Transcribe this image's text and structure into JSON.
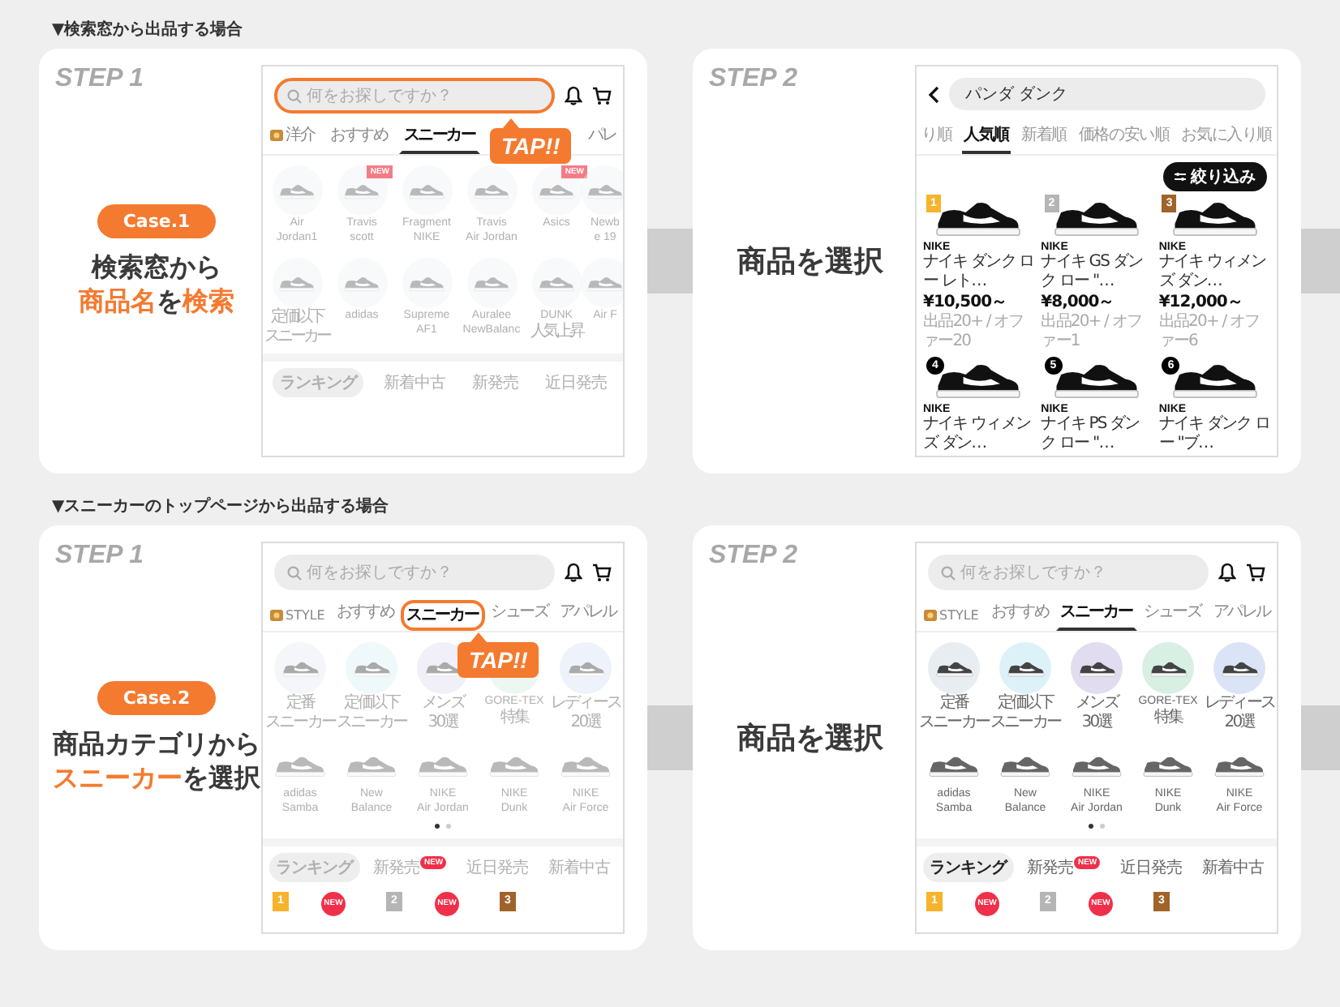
{
  "sections": [
    {
      "heading": "▼検索窓から出品する場合",
      "step1": {
        "step_label": "STEP 1",
        "case_badge": "Case.1",
        "title_lines": [
          [
            {
              "text": "検索窓から",
              "highlight": false
            }
          ],
          [
            {
              "text": "商品名",
              "highlight": true
            },
            {
              "text": "を",
              "highlight": false
            },
            {
              "text": "検索",
              "highlight": true
            }
          ]
        ],
        "screen": {
          "kind": "home",
          "faded": true,
          "search": {
            "placeholder": "何をお探しですか？",
            "highlighted": true
          },
          "callout": {
            "text": "TAP!!"
          },
          "tabs": [
            {
              "label": "洋介",
              "icon": true,
              "selected": false,
              "highlighted": false
            },
            {
              "label": "おすすめ",
              "icon": false,
              "selected": false,
              "highlighted": false
            },
            {
              "label": "スニーカー",
              "icon": false,
              "selected": true,
              "highlighted": false
            },
            {
              "label": "パレ",
              "icon": false,
              "selected": false,
              "highlighted": false
            }
          ],
          "rows": [
            {
              "kind": "circles",
              "items": [
                {
                  "lines": [
                    "Air",
                    "Jordan1"
                  ]
                },
                {
                  "lines": [
                    "Travis",
                    "scott"
                  ],
                  "badge": "NEW"
                },
                {
                  "lines": [
                    "Fragment",
                    "NIKE"
                  ]
                },
                {
                  "lines": [
                    "Travis",
                    "Air Jordan"
                  ]
                },
                {
                  "lines": [
                    "Asics"
                  ],
                  "badge": "NEW"
                },
                {
                  "lines": [
                    "Newb",
                    "e 19"
                  ]
                }
              ]
            },
            {
              "kind": "circles",
              "items": [
                {
                  "lines": [
                    "定価以下",
                    "スニーカー"
                  ]
                },
                {
                  "lines": [
                    "adidas"
                  ]
                },
                {
                  "lines": [
                    "Supreme",
                    "AF1"
                  ]
                },
                {
                  "lines": [
                    "Auralee",
                    "NewBalanc"
                  ]
                },
                {
                  "lines": [
                    "DUNK",
                    "人気上昇"
                  ]
                },
                {
                  "lines": [
                    "Air F"
                  ]
                }
              ]
            }
          ],
          "bottom_tabs": [
            {
              "label": "ランキング",
              "selected": true
            },
            {
              "label": "新着中古",
              "selected": false
            },
            {
              "label": "新発売",
              "selected": false
            },
            {
              "label": "近日発売",
              "selected": false
            }
          ]
        }
      },
      "step2": {
        "step_label": "STEP 2",
        "caption": "商品を選択",
        "screen": {
          "kind": "results",
          "search": {
            "value": "パンダ ダンク"
          },
          "sort_tabs": [
            {
              "label": "り順",
              "selected": false
            },
            {
              "label": "人気順",
              "selected": true
            },
            {
              "label": "新着順",
              "selected": false
            },
            {
              "label": "価格の安い順",
              "selected": false
            },
            {
              "label": "お気に入り順",
              "selected": false
            }
          ],
          "filter_button": "絞り込み",
          "products": [
            {
              "rank": "1",
              "kind": "ribbon",
              "color": "#f7b32b",
              "brand": "NIKE",
              "name": "ナイキ ダンク ロー レト…",
              "price": "¥10,500～",
              "meta": "出品20+ / オファー20"
            },
            {
              "rank": "2",
              "kind": "ribbon",
              "color": "#b5b5b5",
              "brand": "NIKE",
              "name": "ナイキ GS ダンク ロー \"…",
              "price": "¥8,000～",
              "meta": "出品20+ / オファー1"
            },
            {
              "rank": "3",
              "kind": "ribbon",
              "color": "#a0632a",
              "brand": "NIKE",
              "name": "ナイキ ウィメンズ ダン…",
              "price": "¥12,000～",
              "meta": "出品20+ / オファー6"
            },
            {
              "rank": "4",
              "kind": "circle",
              "color": "#000000",
              "brand": "NIKE",
              "name": "ナイキ ウィメンズ ダン…"
            },
            {
              "rank": "5",
              "kind": "circle",
              "color": "#000000",
              "brand": "NIKE",
              "name": "ナイキ PS ダンク ロー \"…"
            },
            {
              "rank": "6",
              "kind": "circle",
              "color": "#000000",
              "brand": "NIKE",
              "name": "ナイキ ダンク ロー \"ブ…"
            }
          ]
        }
      }
    },
    {
      "heading": "▼スニーカーのトップページから出品する場合",
      "step1": {
        "step_label": "STEP 1",
        "case_badge": "Case.2",
        "title_lines": [
          [
            {
              "text": "商品カテゴリから",
              "highlight": false
            }
          ],
          [
            {
              "text": "スニーカー",
              "highlight": true
            },
            {
              "text": "を選択",
              "highlight": false
            }
          ]
        ],
        "screen": {
          "kind": "home",
          "faded": true,
          "search": {
            "placeholder": "何をお探しですか？",
            "highlighted": false
          },
          "callout": {
            "text": "TAP!!"
          },
          "tabs": [
            {
              "label": "STYLE",
              "icon": true,
              "selected": false,
              "highlighted": false
            },
            {
              "label": "おすすめ",
              "icon": false,
              "selected": false,
              "highlighted": false
            },
            {
              "label": "スニーカー",
              "icon": false,
              "selected": true,
              "highlighted": true
            },
            {
              "label": "シューズ",
              "icon": false,
              "selected": false,
              "highlighted": false
            },
            {
              "label": "アパレル",
              "icon": false,
              "selected": false,
              "highlighted": false
            }
          ],
          "rows": [
            {
              "kind": "categories",
              "items": [
                {
                  "lines": [
                    "定番",
                    "スニーカー"
                  ]
                },
                {
                  "lines": [
                    "定価以下",
                    "スニーカー"
                  ]
                },
                {
                  "lines": [
                    "メンズ",
                    "30選"
                  ]
                },
                {
                  "lines": [
                    "GORE-TEX",
                    "特集"
                  ]
                },
                {
                  "lines": [
                    "レディース",
                    "20選"
                  ]
                }
              ]
            },
            {
              "kind": "tiles",
              "items": [
                {
                  "lines": [
                    "adidas",
                    "Samba"
                  ]
                },
                {
                  "lines": [
                    "New",
                    "Balance"
                  ]
                },
                {
                  "lines": [
                    "NIKE",
                    "Air Jordan"
                  ]
                },
                {
                  "lines": [
                    "NIKE",
                    "Dunk"
                  ]
                },
                {
                  "lines": [
                    "NIKE",
                    "Air Force"
                  ]
                }
              ]
            }
          ],
          "pager": [
            {
              "selected": true
            },
            {
              "selected": false
            }
          ],
          "bottom_tabs": [
            {
              "label": "ランキング",
              "selected": true
            },
            {
              "label": "新発売",
              "selected": false,
              "badge": "NEW"
            },
            {
              "label": "近日発売",
              "selected": false
            },
            {
              "label": "新着中古",
              "selected": false
            }
          ],
          "ranking": [
            {
              "rank": "1",
              "color": "#f7b32b",
              "badge": "NEW"
            },
            {
              "rank": "2",
              "color": "#b5b5b5",
              "badge": "NEW"
            },
            {
              "rank": "3",
              "color": "#a0632a"
            }
          ]
        }
      },
      "step2": {
        "step_label": "STEP 2",
        "caption": "商品を選択",
        "screen": {
          "kind": "home",
          "faded": false,
          "search": {
            "placeholder": "何をお探しですか？",
            "highlighted": false
          },
          "tabs": [
            {
              "label": "STYLE",
              "icon": true,
              "selected": false,
              "highlighted": false
            },
            {
              "label": "おすすめ",
              "icon": false,
              "selected": false,
              "highlighted": false
            },
            {
              "label": "スニーカー",
              "icon": false,
              "selected": true,
              "highlighted": false
            },
            {
              "label": "シューズ",
              "icon": false,
              "selected": false,
              "highlighted": false
            },
            {
              "label": "アパレル",
              "icon": false,
              "selected": false,
              "highlighted": false
            }
          ],
          "rows": [
            {
              "kind": "categories",
              "items": [
                {
                  "lines": [
                    "定番",
                    "スニーカー"
                  ]
                },
                {
                  "lines": [
                    "定価以下",
                    "スニーカー"
                  ]
                },
                {
                  "lines": [
                    "メンズ",
                    "30選"
                  ]
                },
                {
                  "lines": [
                    "GORE-TEX",
                    "特集"
                  ]
                },
                {
                  "lines": [
                    "レディース",
                    "20選"
                  ]
                }
              ]
            },
            {
              "kind": "tiles",
              "items": [
                {
                  "lines": [
                    "adidas",
                    "Samba"
                  ]
                },
                {
                  "lines": [
                    "New",
                    "Balance"
                  ]
                },
                {
                  "lines": [
                    "NIKE",
                    "Air Jordan"
                  ]
                },
                {
                  "lines": [
                    "NIKE",
                    "Dunk"
                  ]
                },
                {
                  "lines": [
                    "NIKE",
                    "Air Force"
                  ]
                }
              ]
            }
          ],
          "pager": [
            {
              "selected": true
            },
            {
              "selected": false
            }
          ],
          "bottom_tabs": [
            {
              "label": "ランキング",
              "selected": true
            },
            {
              "label": "新発売",
              "selected": false,
              "badge": "NEW"
            },
            {
              "label": "近日発売",
              "selected": false
            },
            {
              "label": "新着中古",
              "selected": false
            }
          ],
          "ranking": [
            {
              "rank": "1",
              "color": "#f7b32b",
              "badge": "NEW"
            },
            {
              "rank": "2",
              "color": "#b5b5b5",
              "badge": "NEW"
            },
            {
              "rank": "3",
              "color": "#a0632a"
            }
          ]
        }
      }
    }
  ]
}
